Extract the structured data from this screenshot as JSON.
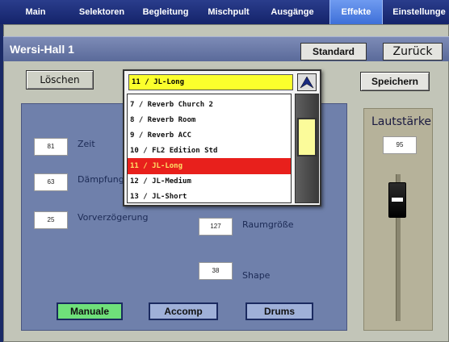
{
  "tabs": [
    {
      "label": "Main",
      "active": false
    },
    {
      "label": "Selektoren",
      "active": false
    },
    {
      "label": "Begleitung",
      "active": false
    },
    {
      "label": "Mischpult",
      "active": false
    },
    {
      "label": "Ausgänge",
      "active": false
    },
    {
      "label": "Effekte",
      "active": true
    },
    {
      "label": "Einstellunge",
      "active": false
    }
  ],
  "header": {
    "title": "Wersi-Hall 1",
    "standard_label": "Standard",
    "back_label": "Zurück"
  },
  "toolbar": {
    "delete_label": "Löschen",
    "save_label": "Speichern"
  },
  "params": {
    "zeit": {
      "label": "Zeit",
      "value": "81"
    },
    "daempfung": {
      "label": "Dämpfung",
      "value": "63"
    },
    "vorverzoegerung": {
      "label": "Vorverzögerung",
      "value": "25"
    },
    "raumgroesse": {
      "label": "Raumgröße",
      "value": "127"
    },
    "shape": {
      "label": "Shape",
      "value": "38"
    }
  },
  "modes": {
    "manuale": "Manuale",
    "accomp": "Accomp",
    "drums": "Drums"
  },
  "volume": {
    "label": "Lautstärke",
    "value": "95"
  },
  "dropdown": {
    "selected": "11 / JL-Long",
    "items": [
      "7 / Reverb Church 2",
      "8 / Reverb Room",
      "9 / Reverb ACC",
      "10 / FL2 Edition Std",
      "11 / JL-Long",
      "12 / JL-Medium",
      "13 / JL-Short"
    ],
    "selected_index": 4
  },
  "colors": {
    "active_tab": "#4a7ae0",
    "selected_item": "#e8201c",
    "dropdown_current": "#fbff2c",
    "manuale_active": "#6fe07a"
  }
}
